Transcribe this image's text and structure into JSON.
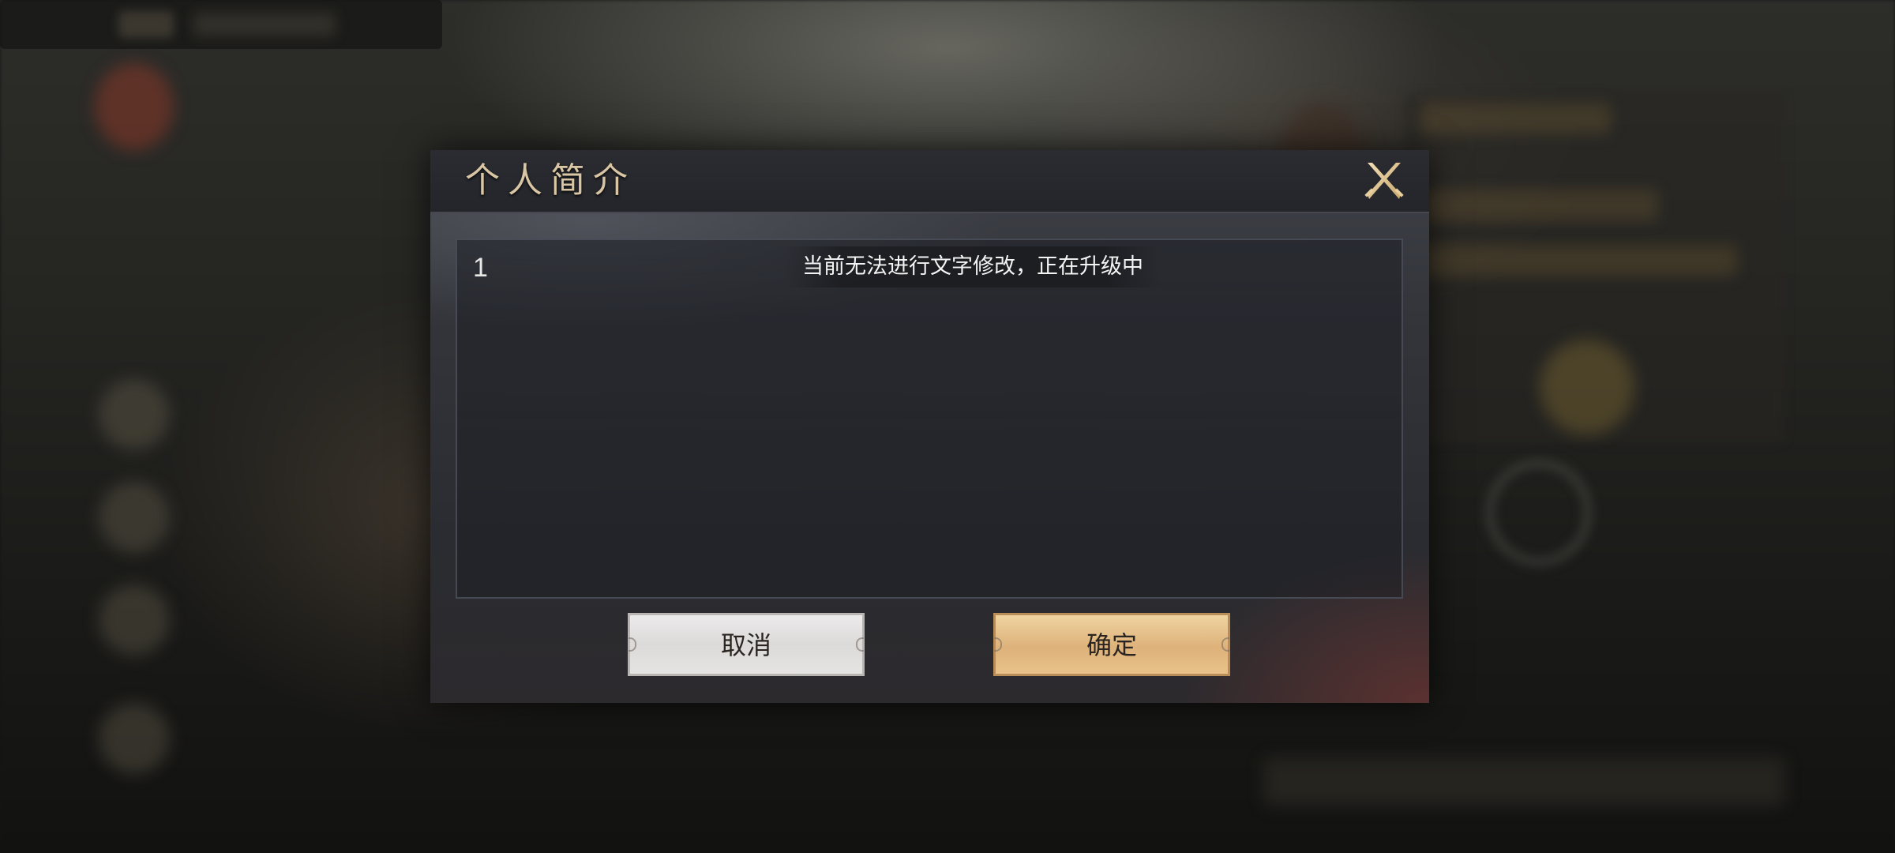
{
  "dialog": {
    "title": "个人简介",
    "content_value": "1",
    "toast_message": "当前无法进行文字修改，正在升级中",
    "cancel_label": "取消",
    "confirm_label": "确定"
  },
  "colors": {
    "title_gold": "#d8c6a4",
    "confirm_button": "#deb27a",
    "cancel_button": "#dcd9d9",
    "dialog_background": "#33353b"
  },
  "icons": {
    "close": "crossed-blades-close-icon"
  }
}
